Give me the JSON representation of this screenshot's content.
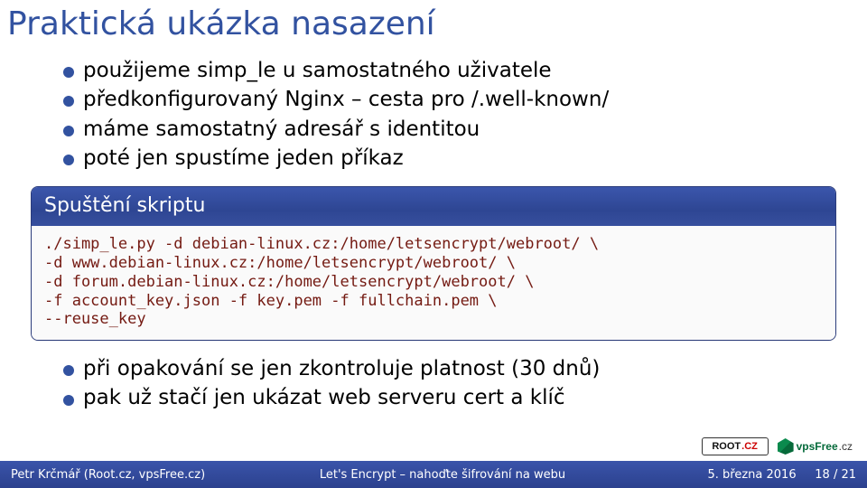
{
  "title": "Praktická ukázka nasazení",
  "bullets_top": [
    "použijeme simp_le u samostatného uživatele",
    "předkonfigurovaný Nginx – cesta pro /.well-known/",
    "máme samostatný adresář s identitou",
    "poté jen spustíme jeden příkaz"
  ],
  "box": {
    "head": "Spuštění skriptu",
    "code": "./simp_le.py -d debian-linux.cz:/home/letsencrypt/webroot/ \\\n-d www.debian-linux.cz:/home/letsencrypt/webroot/ \\\n-d forum.debian-linux.cz:/home/letsencrypt/webroot/ \\\n-f account_key.json -f key.pem -f fullchain.pem \\\n--reuse_key"
  },
  "bullets_bottom": [
    "při opakování se jen zkontroluje platnost (30 dnů)",
    "pak už stačí jen ukázat web serveru cert a klíč"
  ],
  "logos": {
    "root_text": "ROOT",
    "root_suffix": ".CZ",
    "vps_text": "vpsFree",
    "vps_suffix": ".cz"
  },
  "footer": {
    "left": "Petr Krčmář (Root.cz, vpsFree.cz)",
    "center": "Let's Encrypt – nahoďte šifrování na webu",
    "date": "5. března 2016",
    "page": "18 / 21"
  }
}
